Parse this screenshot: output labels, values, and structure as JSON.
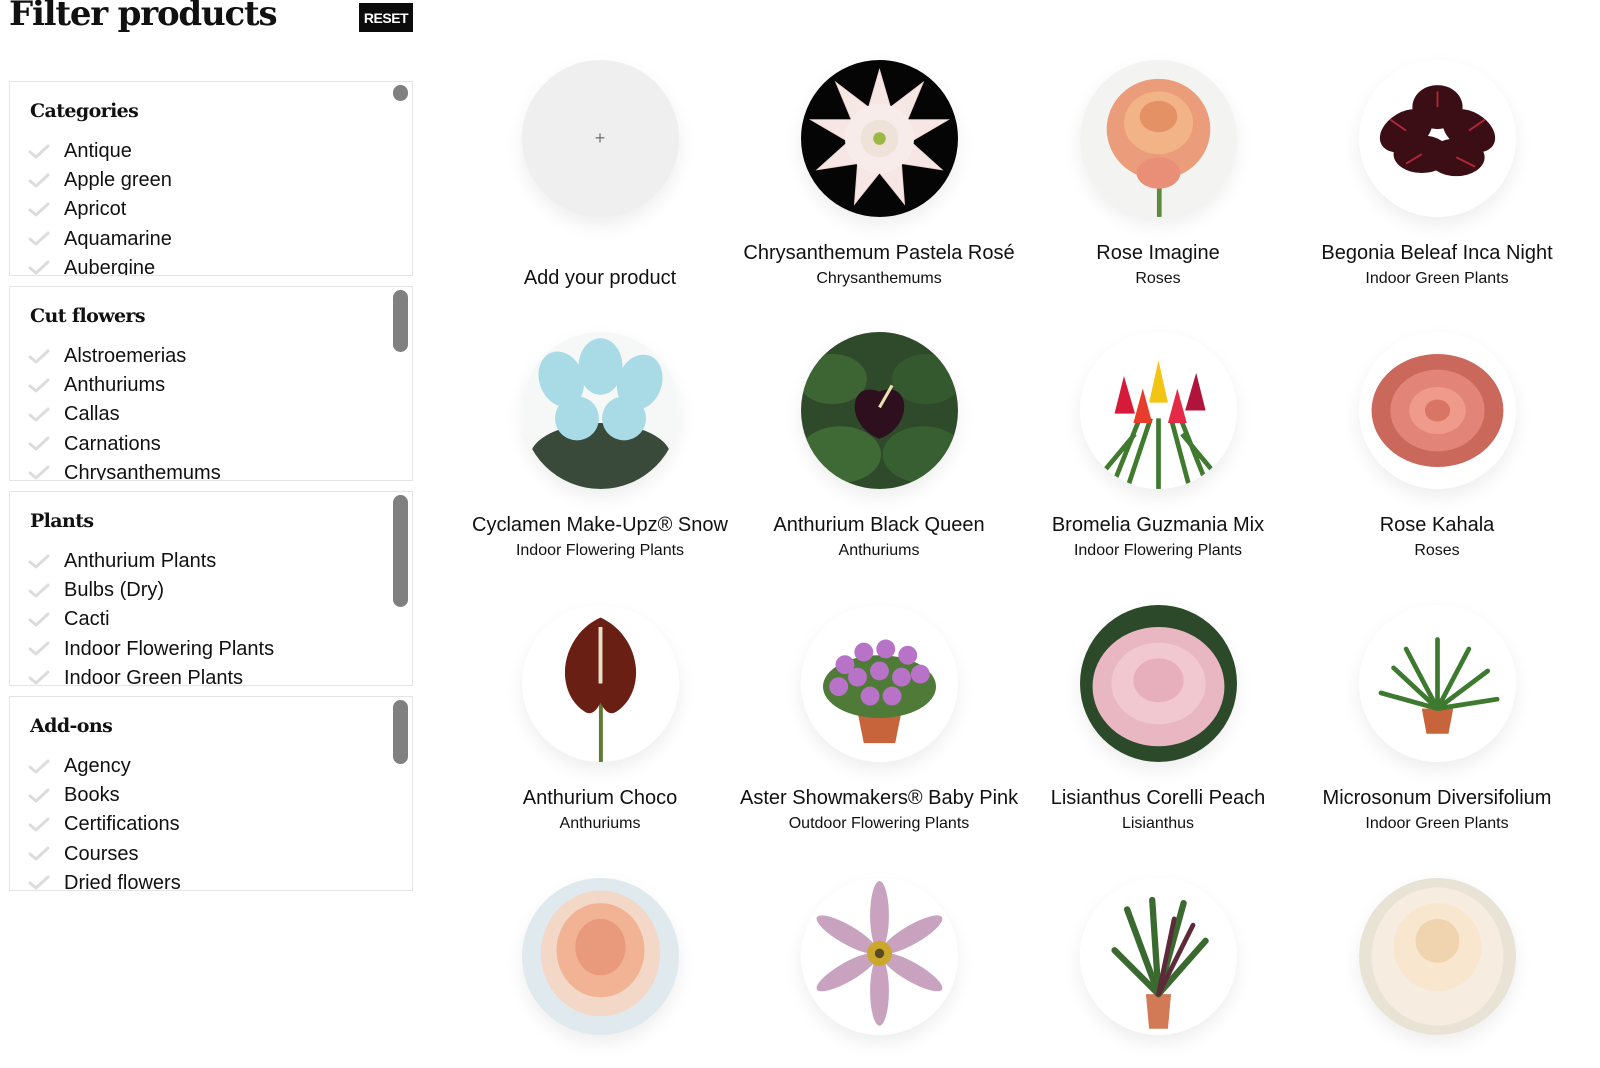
{
  "header": {
    "title": "Filter products",
    "reset_label": "RESET"
  },
  "filters": [
    {
      "title": "Categories",
      "items": [
        "Antique",
        "Apple green",
        "Apricot",
        "Aquamarine",
        "Aubergine"
      ]
    },
    {
      "title": "Cut flowers",
      "items": [
        "Alstroemerias",
        "Anthuriums",
        "Callas",
        "Carnations",
        "Chrysanthemums"
      ]
    },
    {
      "title": "Plants",
      "items": [
        "Anthurium Plants",
        "Bulbs (Dry)",
        "Cacti",
        "Indoor Flowering Plants",
        "Indoor Green Plants"
      ]
    },
    {
      "title": "Add-ons",
      "items": [
        "Agency",
        "Books",
        "Certifications",
        "Courses",
        "Dried flowers"
      ]
    }
  ],
  "add_product": {
    "label": "Add your product",
    "plus": "+"
  },
  "products": [
    {
      "name": "Chrysanthemum Pastela Rosé",
      "category": "Chrysanthemums",
      "image": "white-chrysanthemum"
    },
    {
      "name": "Rose Imagine",
      "category": "Roses",
      "image": "peach-rose"
    },
    {
      "name": "Begonia Beleaf Inca Night",
      "category": "Indoor Green Plants",
      "image": "dark-red-begonia"
    },
    {
      "name": "Cyclamen Make-Upz® Snow",
      "category": "Indoor Flowering Plants",
      "image": "light-blue-cyclamen"
    },
    {
      "name": "Anthurium Black Queen",
      "category": "Anthuriums",
      "image": "dark-anthurium"
    },
    {
      "name": "Bromelia Guzmania Mix",
      "category": "Indoor Flowering Plants",
      "image": "bromelia-mix"
    },
    {
      "name": "Rose Kahala",
      "category": "Roses",
      "image": "coral-rose"
    },
    {
      "name": "Anthurium Choco",
      "category": "Anthuriums",
      "image": "brown-anthurium"
    },
    {
      "name": "Aster Showmakers® Baby Pink",
      "category": "Outdoor Flowering Plants",
      "image": "purple-aster-pot"
    },
    {
      "name": "Lisianthus Corelli Peach",
      "category": "Lisianthus",
      "image": "pink-lisianthus"
    },
    {
      "name": "Microsonum Diversifolium",
      "category": "Indoor Green Plants",
      "image": "fern-pot"
    },
    {
      "name": "",
      "category": "",
      "image": "salmon-rose"
    },
    {
      "name": "",
      "category": "",
      "image": "lilac-clematis"
    },
    {
      "name": "",
      "category": "",
      "image": "calathea-pot"
    },
    {
      "name": "",
      "category": "",
      "image": "cream-rose"
    }
  ]
}
